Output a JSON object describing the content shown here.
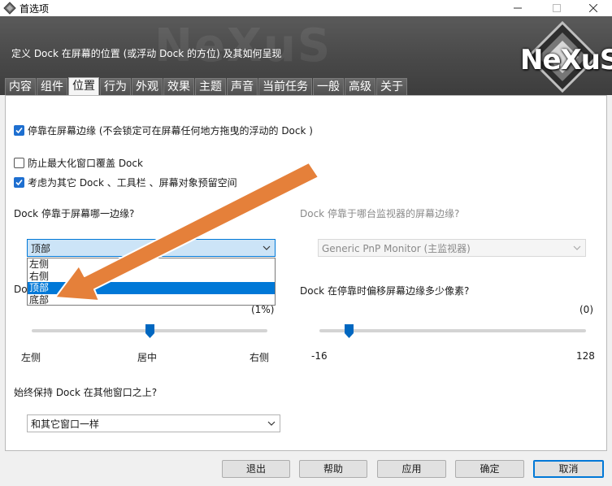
{
  "window": {
    "title": "首选项",
    "min_icon": "minimize-icon",
    "max_icon": "maximize-icon",
    "close_icon": "close-icon"
  },
  "banner": {
    "description": "定义 Dock 在屏幕的位置 (或浮动 Dock 的方位) 及其如何呈现",
    "logo": "NeXuS",
    "watermark": "NeXuS"
  },
  "tabs": [
    {
      "label": "内容",
      "active": false
    },
    {
      "label": "组件",
      "active": false
    },
    {
      "label": "位置",
      "active": true
    },
    {
      "label": "行为",
      "active": false
    },
    {
      "label": "外观",
      "active": false
    },
    {
      "label": "效果",
      "active": false
    },
    {
      "label": "主题",
      "active": false
    },
    {
      "label": "声音",
      "active": false
    },
    {
      "label": "当前任务",
      "active": false
    },
    {
      "label": "一般",
      "active": false
    },
    {
      "label": "高级",
      "active": false
    },
    {
      "label": "关于",
      "active": false
    }
  ],
  "options": {
    "dock_to_edge": {
      "label": "停靠在屏幕边缘 (不会锁定可在屏幕任何地方拖曳的浮动的 Dock )",
      "checked": true
    },
    "prevent_cover": {
      "label": "防止最大化窗口覆盖 Dock",
      "checked": false
    },
    "reserve_space": {
      "label": "考虑为其它 Dock 、工具栏 、屏幕对象预留空间",
      "checked": true
    }
  },
  "edge_select": {
    "question": "Dock 停靠于屏幕哪一边缘?",
    "value": "顶部",
    "options": [
      "左侧",
      "右侧",
      "顶部",
      "底部"
    ],
    "highlighted_index": 2
  },
  "monitor_select": {
    "question": "Dock 停靠于哪台监视器的屏幕边缘?",
    "value": "Generic PnP Monitor (主监视器)"
  },
  "position_slider": {
    "question_prefix": "Do",
    "value_label": "(1%)",
    "value": 0.5,
    "left_label": "左侧",
    "center_label": "居中",
    "right_label": "右侧"
  },
  "offset_slider": {
    "question": "Dock 在停靠时偏移屏幕边缘多少像素?",
    "value_label": "(0)",
    "min_label": "-16",
    "max_label": "128",
    "min": -16,
    "max": 128,
    "value": 0
  },
  "ontop_select": {
    "question": "始终保持 Dock 在其他窗口之上?",
    "value": "和其它窗口一样"
  },
  "buttons": {
    "exit": "退出",
    "help": "帮助",
    "apply": "应用",
    "ok": "确定",
    "cancel": "取消"
  },
  "annotation": {
    "color": "#e5803a",
    "icon": "pointer-arrow"
  }
}
